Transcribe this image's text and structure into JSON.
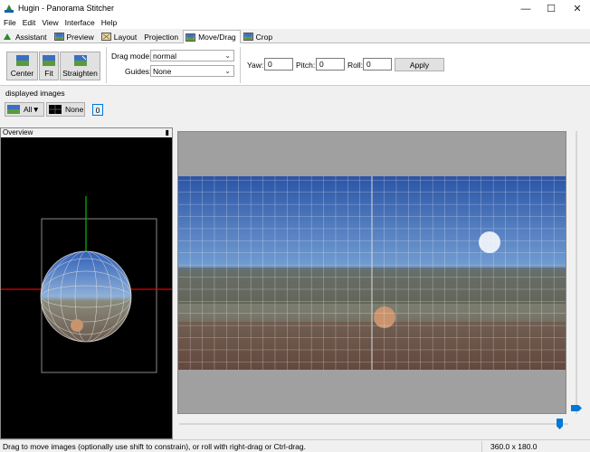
{
  "window": {
    "title": "Hugin - Panorama Stitcher"
  },
  "menu": [
    "File",
    "Edit",
    "View",
    "Interface",
    "Help"
  ],
  "tabs": [
    {
      "label": "Assistant",
      "icon": "assistant-icon"
    },
    {
      "label": "Preview",
      "icon": "preview-icon"
    },
    {
      "label": "Layout",
      "icon": "layout-icon"
    },
    {
      "label": "Projection",
      "icon": ""
    },
    {
      "label": "Move/Drag",
      "icon": "move-drag-icon",
      "active": true
    },
    {
      "label": "Crop",
      "icon": "crop-icon"
    }
  ],
  "toolbar": {
    "center_label": "Center",
    "fit_label": "Fit",
    "straighten_label": "Straighten",
    "drag_mode_label": "Drag mode:",
    "drag_mode_value": "normal",
    "guides_label": "Guides:",
    "guides_value": "None",
    "yaw_label": "Yaw:",
    "yaw_value": "0",
    "pitch_label": "Pitch:",
    "pitch_value": "0",
    "roll_label": "Roll:",
    "roll_value": "0",
    "apply_label": "Apply"
  },
  "displayed_images": {
    "label": "displayed images",
    "all_label": "All▼",
    "none_label": "None",
    "image_number": "0"
  },
  "overview": {
    "title": "Overview"
  },
  "status": {
    "message": "Drag to move images (optionally use shift to constrain), or roll with right-drag or Ctrl-drag.",
    "fov": "360.0 x 180.0"
  },
  "colors": {
    "accent": "#0078d7",
    "overview_bg": "#000000",
    "preview_bg": "#a0a0a0",
    "grid": "#ffffff"
  }
}
